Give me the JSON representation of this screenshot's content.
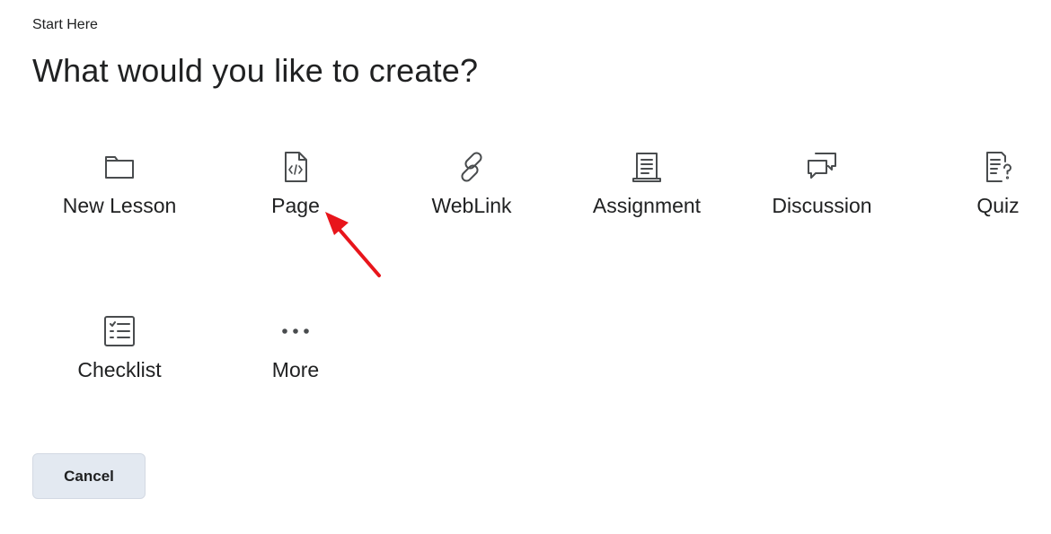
{
  "breadcrumb": "Start Here",
  "heading": "What would you like to create?",
  "options": [
    {
      "label": "New Lesson",
      "icon": "folder-icon"
    },
    {
      "label": "Page",
      "icon": "file-code-icon"
    },
    {
      "label": "WebLink",
      "icon": "link-icon"
    },
    {
      "label": "Assignment",
      "icon": "assignment-icon"
    },
    {
      "label": "Discussion",
      "icon": "discussion-icon"
    },
    {
      "label": "Quiz",
      "icon": "quiz-icon"
    },
    {
      "label": "Checklist",
      "icon": "checklist-icon"
    },
    {
      "label": "More",
      "icon": "more-icon"
    }
  ],
  "cancel_label": "Cancel",
  "annotation": {
    "arrow_color": "#e8151b",
    "points_to": "Page"
  },
  "colors": {
    "text": "#202122",
    "icon": "#494c4e",
    "button_bg": "#e3e9f1"
  }
}
